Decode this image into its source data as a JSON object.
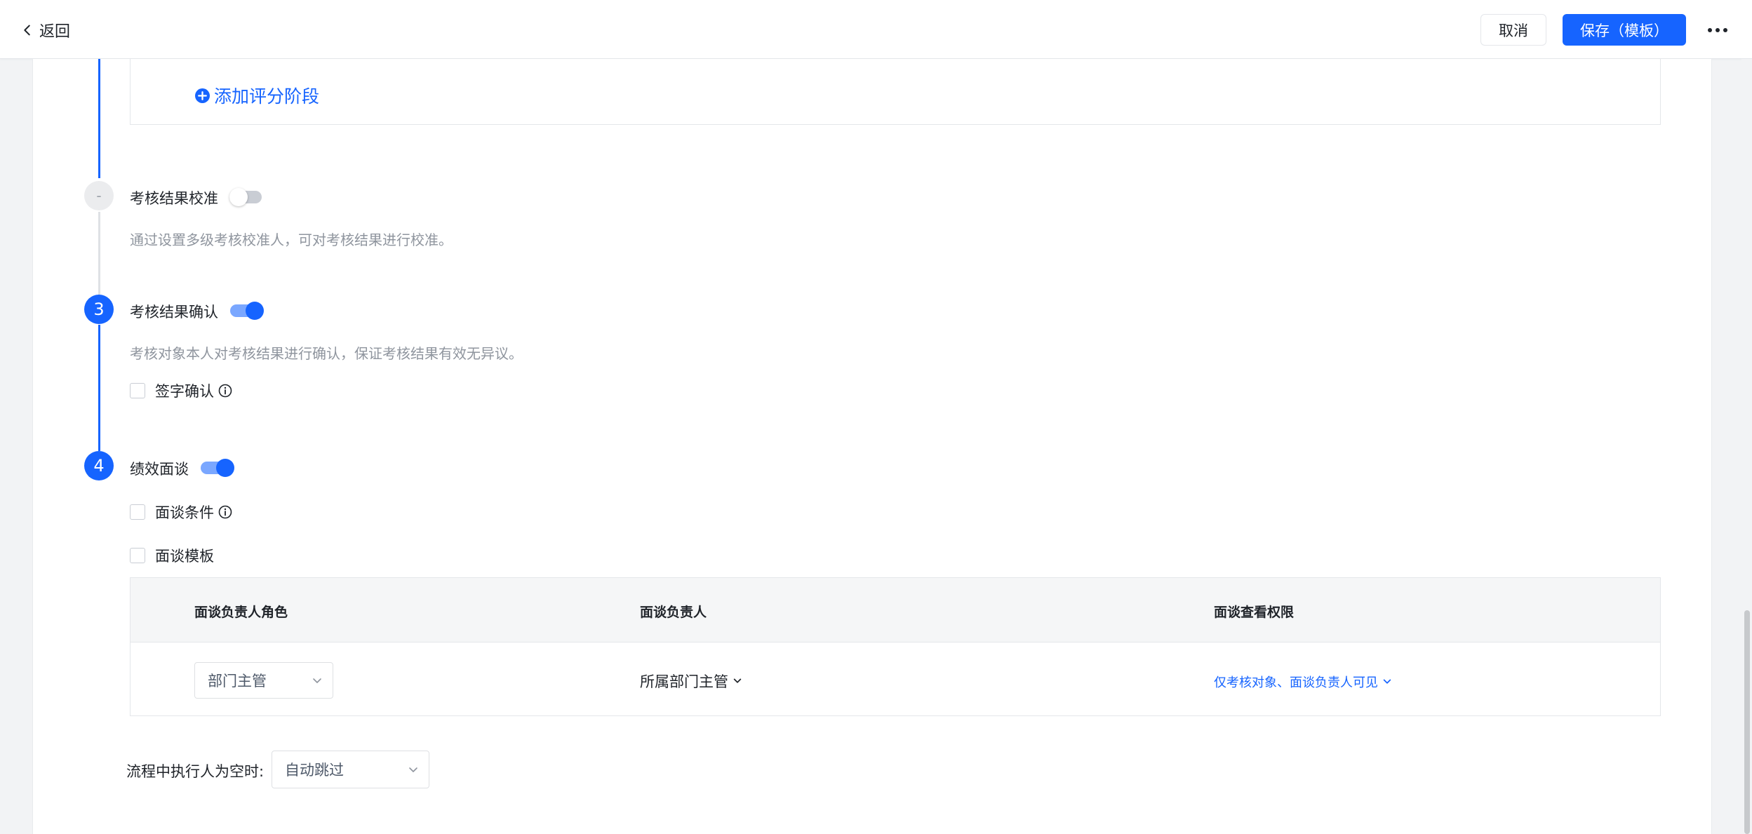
{
  "header": {
    "back_label": "返回",
    "cancel_label": "取消",
    "save_label": "保存（模板）"
  },
  "stages": {
    "add_stage_label": "添加评分阶段",
    "calibration": {
      "number": "-",
      "title": "考核结果校准",
      "enabled": false,
      "description": "通过设置多级考核校准人，可对考核结果进行校准。"
    },
    "confirmation": {
      "number": "3",
      "title": "考核结果确认",
      "enabled": true,
      "description": "考核对象本人对考核结果进行确认，保证考核结果有效无异议。",
      "signature_label": "签字确认"
    },
    "interview": {
      "number": "4",
      "title": "绩效面谈",
      "enabled": true,
      "condition_label": "面谈条件",
      "template_label": "面谈模板",
      "table": {
        "headers": [
          "面谈负责人角色",
          "面谈负责人",
          "面谈查看权限"
        ],
        "row": {
          "role": "部门主管",
          "owner": "所属部门主管",
          "permission": "仅考核对象、面谈负责人可见"
        }
      }
    }
  },
  "empty_executor": {
    "label": "流程中执行人为空时:",
    "value": "自动跳过"
  }
}
